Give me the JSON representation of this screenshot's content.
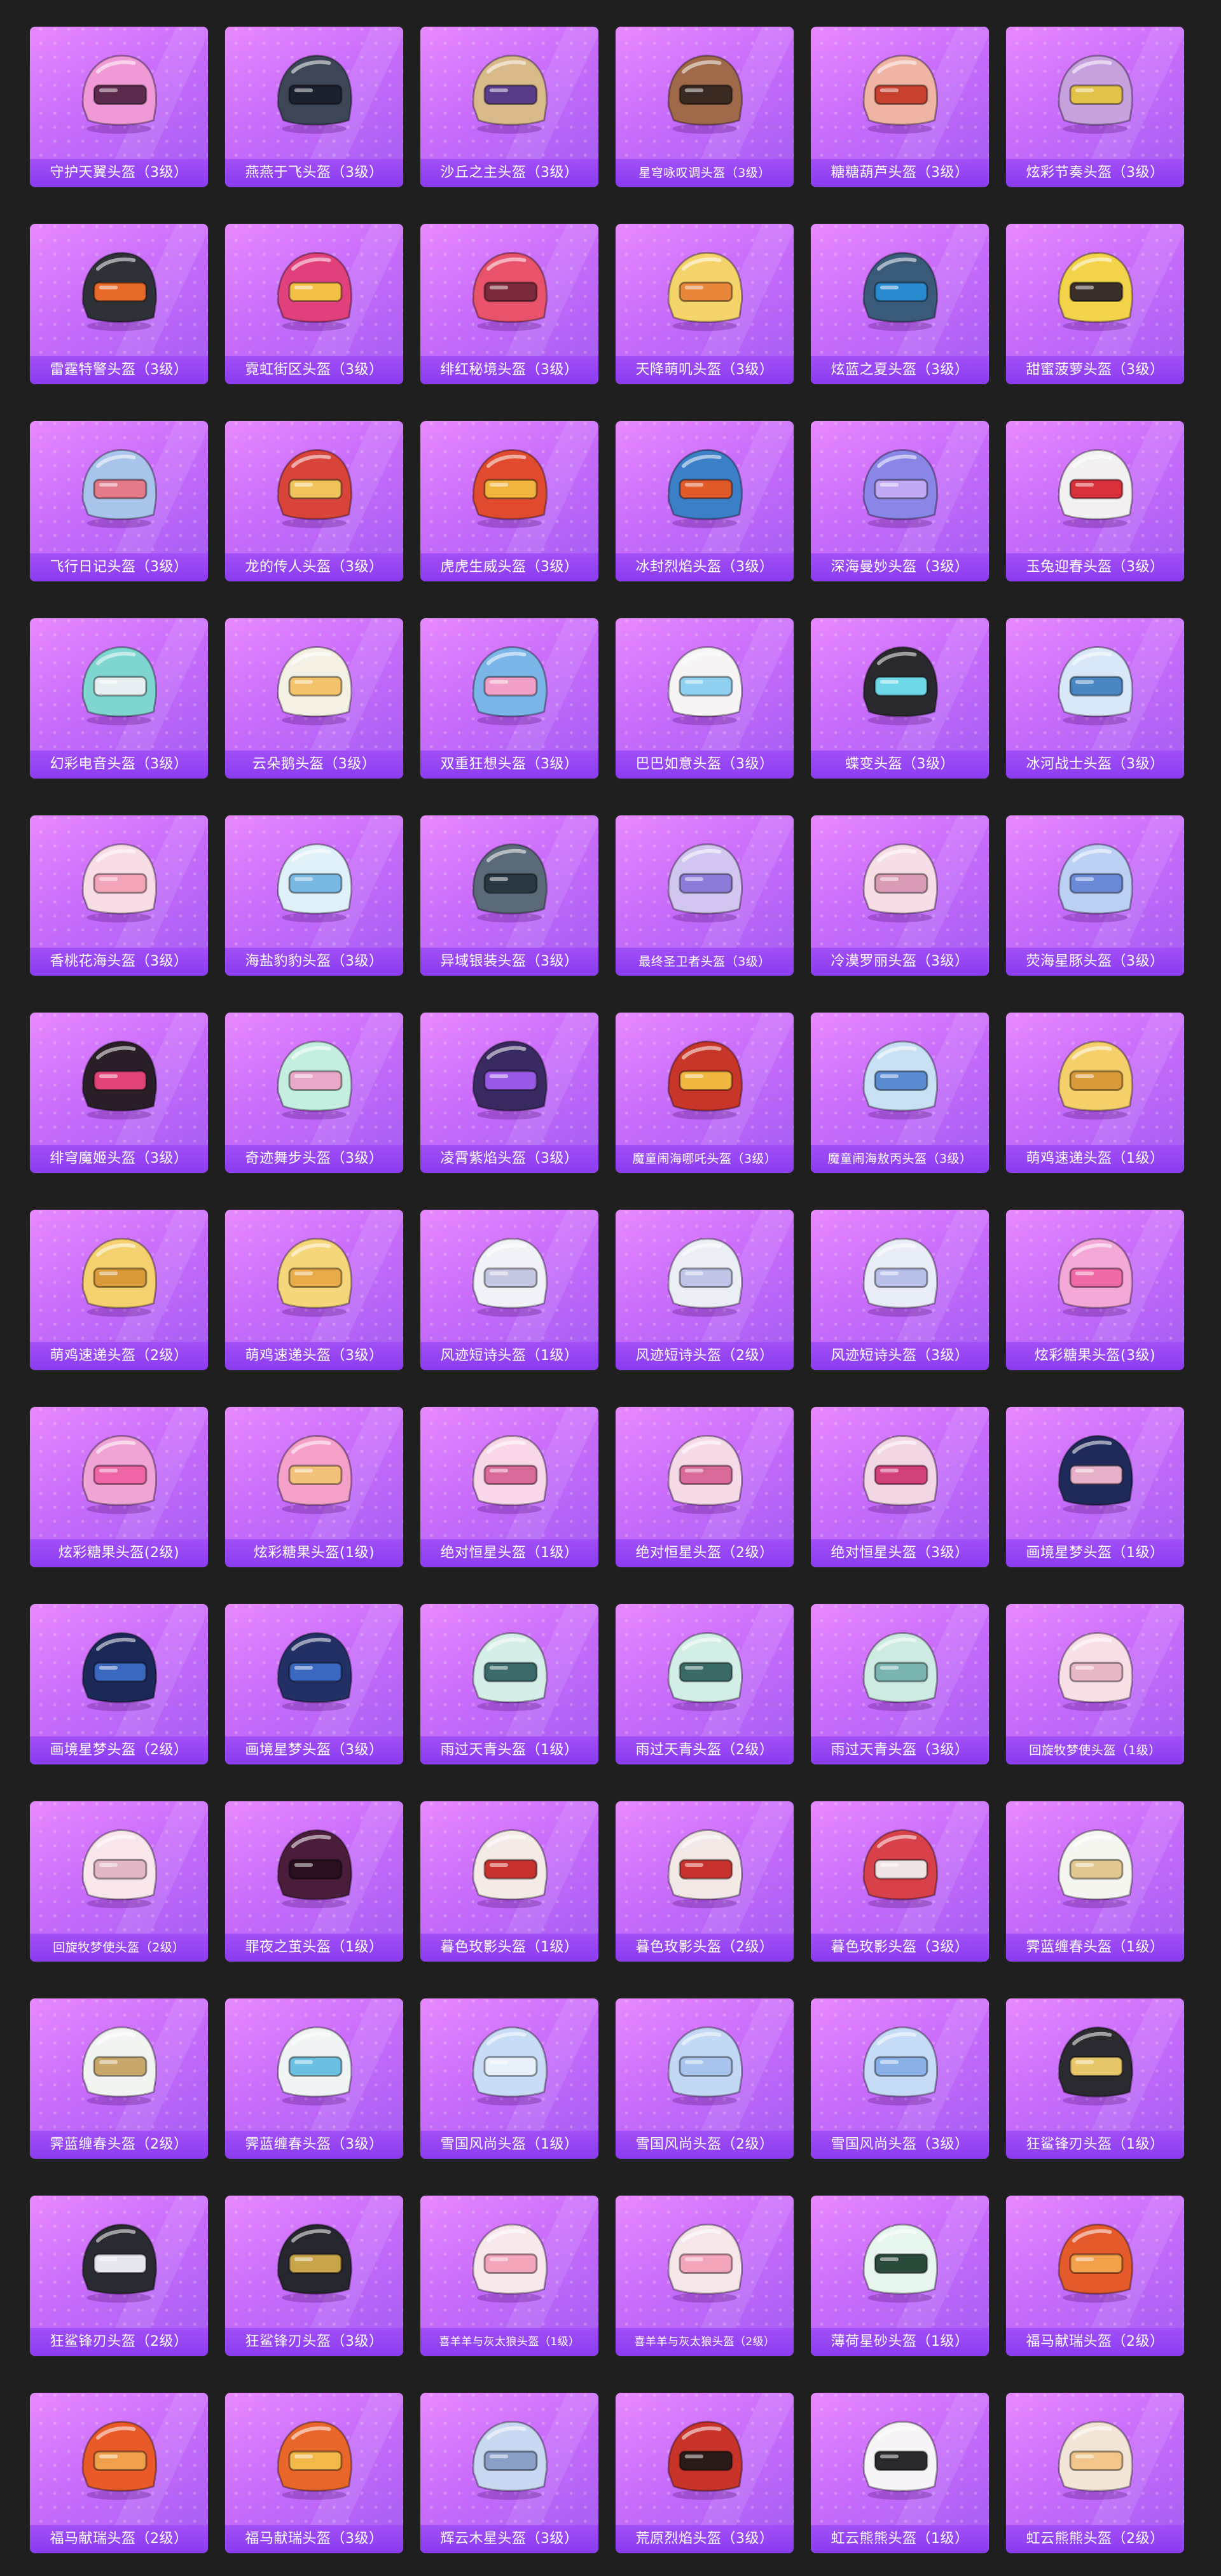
{
  "items": [
    {
      "name": "守护天翼头盔（3级）",
      "shell": "#ef9ad6",
      "visor": "#5b2a4d"
    },
    {
      "name": "燕燕于飞头盔（3级）",
      "shell": "#3d4656",
      "visor": "#1c2130"
    },
    {
      "name": "沙丘之主头盔（3级）",
      "shell": "#d8b98a",
      "visor": "#5a3d8a"
    },
    {
      "name": "星穹咏叹调头盔（3级）",
      "shell": "#a06a4a",
      "visor": "#3a2a22"
    },
    {
      "name": "糖糖葫芦头盔（3级）",
      "shell": "#f0b4a4",
      "visor": "#c8412f"
    },
    {
      "name": "炫彩节奏头盔（3级）",
      "shell": "#c7a1dd",
      "visor": "#e2c24a"
    },
    {
      "name": "雷霆特警头盔（3级）",
      "shell": "#2f3138",
      "visor": "#e86a2a"
    },
    {
      "name": "霓虹街区头盔（3级）",
      "shell": "#e0417c",
      "visor": "#f2c046"
    },
    {
      "name": "绯红秘境头盔（3级）",
      "shell": "#e8526a",
      "visor": "#7a2a3a"
    },
    {
      "name": "天降萌叽头盔（3级）",
      "shell": "#f4d46a",
      "visor": "#e8873a"
    },
    {
      "name": "炫蓝之夏头盔（3级）",
      "shell": "#3a5a7a",
      "visor": "#2a8ad0"
    },
    {
      "name": "甜蜜菠萝头盔（3级）",
      "shell": "#f2d34a",
      "visor": "#3a2f2a"
    },
    {
      "name": "飞行日记头盔（3级）",
      "shell": "#a8c4ea",
      "visor": "#e37b8b"
    },
    {
      "name": "龙的传人头盔（3级）",
      "shell": "#d8443a",
      "visor": "#f0c45a"
    },
    {
      "name": "虎虎生威头盔（3级）",
      "shell": "#e04a2e",
      "visor": "#f2b640"
    },
    {
      "name": "冰封烈焰头盔（3级）",
      "shell": "#3b7fc6",
      "visor": "#e05a2a"
    },
    {
      "name": "深海曼妙头盔（3级）",
      "shell": "#8a86e8",
      "visor": "#c2a9f4"
    },
    {
      "name": "玉兔迎春头盔（3级）",
      "shell": "#f2f0f0",
      "visor": "#d8303a"
    },
    {
      "name": "幻彩电音头盔（3级）",
      "shell": "#7fd6d0",
      "visor": "#e6eef2"
    },
    {
      "name": "云朵鹅头盔（3级）",
      "shell": "#f4f1e4",
      "visor": "#f2c36a"
    },
    {
      "name": "双重狂想头盔（3级）",
      "shell": "#7ab6e8",
      "visor": "#f0a0c6"
    },
    {
      "name": "巴巴如意头盔（3级）",
      "shell": "#f6f4f4",
      "visor": "#8fd0f0"
    },
    {
      "name": "蝶变头盔（3级）",
      "shell": "#2a2a2e",
      "visor": "#6fd8e8"
    },
    {
      "name": "冰河战士头盔（3级）",
      "shell": "#d8e8f8",
      "visor": "#4a86c2"
    },
    {
      "name": "香桃花海头盔（3级）",
      "shell": "#f8dce6",
      "visor": "#f2a4b8"
    },
    {
      "name": "海盐豹豹头盔（3级）",
      "shell": "#dff0f8",
      "visor": "#7ab8e4"
    },
    {
      "name": "异域银装头盔（3级）",
      "shell": "#5a6a78",
      "visor": "#2a3844"
    },
    {
      "name": "最终圣卫者头盔（3级）",
      "shell": "#d2c6f0",
      "visor": "#8e7ad8"
    },
    {
      "name": "冷漠罗丽头盔（3级）",
      "shell": "#f6dde6",
      "visor": "#d89ab4"
    },
    {
      "name": "荧海星豚头盔（3级）",
      "shell": "#bcd0f4",
      "visor": "#6a8ad8"
    },
    {
      "name": "绯穹魔姬头盔（3级）",
      "shell": "#2a1f28",
      "visor": "#e2447a"
    },
    {
      "name": "奇迹舞步头盔（3级）",
      "shell": "#c4efe0",
      "visor": "#e8a8c8"
    },
    {
      "name": "凌霄紫焰头盔（3级）",
      "shell": "#3a2a62",
      "visor": "#9a5ae8"
    },
    {
      "name": "魔童闹海哪吒头盔（3级）",
      "shell": "#c8362a",
      "visor": "#f0b840"
    },
    {
      "name": "魔童闹海敖丙头盔（3级）",
      "shell": "#c8e0f4",
      "visor": "#5a8ad0"
    },
    {
      "name": "萌鸡速递头盔（1级）",
      "shell": "#f4cf6a",
      "visor": "#d99a3a"
    },
    {
      "name": "萌鸡速递头盔（2级）",
      "shell": "#f4d06e",
      "visor": "#d99a3a"
    },
    {
      "name": "萌鸡速递头盔（3级）",
      "shell": "#f6d67a",
      "visor": "#e8ab4a"
    },
    {
      "name": "风迹短诗头盔（1级）",
      "shell": "#f0f2f8",
      "visor": "#c4c8e0"
    },
    {
      "name": "风迹短诗头盔（2级）",
      "shell": "#eceef6",
      "visor": "#c0c4e6"
    },
    {
      "name": "风迹短诗头盔（3级）",
      "shell": "#e8ecf6",
      "visor": "#b8c0ea"
    },
    {
      "name": "炫彩糖果头盔(3级)",
      "shell": "#f4a8d8",
      "visor": "#f06aa8"
    },
    {
      "name": "炫彩糖果头盔(2级)",
      "shell": "#f0a4d6",
      "visor": "#ee66a6"
    },
    {
      "name": "炫彩糖果头盔(1级)",
      "shell": "#f4a0c8",
      "visor": "#f2c27a"
    },
    {
      "name": "绝对恒星头盔（1级）",
      "shell": "#f8d8e8",
      "visor": "#d86a9a"
    },
    {
      "name": "绝对恒星头盔（2级）",
      "shell": "#f6dae8",
      "visor": "#d86a9a"
    },
    {
      "name": "绝对恒星头盔（3级）",
      "shell": "#f2d6e4",
      "visor": "#d2407a"
    },
    {
      "name": "画境星梦头盔（1级）",
      "shell": "#1f2a5a",
      "visor": "#e6b0c8"
    },
    {
      "name": "画境星梦头盔（2级）",
      "shell": "#1c2858",
      "visor": "#3a68c0"
    },
    {
      "name": "画境星梦头盔（3级）",
      "shell": "#223066",
      "visor": "#3a68c0"
    },
    {
      "name": "雨过天青头盔（1级）",
      "shell": "#d6eee8",
      "visor": "#3a6a6a"
    },
    {
      "name": "雨过天青头盔（2级）",
      "shell": "#d2eee6",
      "visor": "#3a6a66"
    },
    {
      "name": "雨过天青头盔（3级）",
      "shell": "#cdebe2",
      "visor": "#7ab4b0"
    },
    {
      "name": "回旋牧梦使头盔（1级）",
      "shell": "#f8e0e6",
      "visor": "#e8b8c6"
    },
    {
      "name": "回旋牧梦使头盔（2级）",
      "shell": "#f8e6ea",
      "visor": "#e2b8c6"
    },
    {
      "name": "罪夜之茧头盔（1级）",
      "shell": "#4a1e3a",
      "visor": "#2a0f20"
    },
    {
      "name": "暮色玫影头盔（1级）",
      "shell": "#f4ebe6",
      "visor": "#c8322e"
    },
    {
      "name": "暮色玫影头盔（2级）",
      "shell": "#f2e8e6",
      "visor": "#c8322e"
    },
    {
      "name": "暮色玫影头盔（3级）",
      "shell": "#d8404a",
      "visor": "#f0e4e6"
    },
    {
      "name": "霁蓝缠春头盔（1级）",
      "shell": "#f6f6f0",
      "visor": "#e0c890"
    },
    {
      "name": "霁蓝缠春头盔（2级）",
      "shell": "#f2f4f2",
      "visor": "#c8a86a"
    },
    {
      "name": "霁蓝缠春头盔（3级）",
      "shell": "#f0f4f4",
      "visor": "#6ac0e0"
    },
    {
      "name": "雪国风尚头盔（1级）",
      "shell": "#c8dcf6",
      "visor": "#e8f0fa"
    },
    {
      "name": "雪国风尚头盔（2级）",
      "shell": "#c2d8f4",
      "visor": "#a8c4ec"
    },
    {
      "name": "雪国风尚头盔（3级）",
      "shell": "#c6dcf6",
      "visor": "#8ab0e8"
    },
    {
      "name": "狂鲨锋刃头盔（1级）",
      "shell": "#2a2a30",
      "visor": "#e8c66a"
    },
    {
      "name": "狂鲨锋刃头盔（2级）",
      "shell": "#2a2a32",
      "visor": "#e6e6ee"
    },
    {
      "name": "狂鲨锋刃头盔（3级）",
      "shell": "#26262e",
      "visor": "#c8a44a"
    },
    {
      "name": "喜羊羊与灰太狼头盔（1级）",
      "shell": "#f8e8ec",
      "visor": "#f2a4b8"
    },
    {
      "name": "喜羊羊与灰太狼头盔（2级）",
      "shell": "#f6e6ea",
      "visor": "#f2a4b8"
    },
    {
      "name": "薄荷星砂头盔（1级）",
      "shell": "#e6f6ee",
      "visor": "#2a4a3a"
    },
    {
      "name": "福马献瑞头盔（2级）",
      "shell": "#e45a2a",
      "visor": "#f2a04a"
    },
    {
      "name": "福马献瑞头盔（2级）",
      "shell": "#e85a28",
      "visor": "#f0a04a"
    },
    {
      "name": "福马献瑞头盔（3级）",
      "shell": "#e8662a",
      "visor": "#f2b84a"
    },
    {
      "name": "辉云木星头盔（3级）",
      "shell": "#c8d8f0",
      "visor": "#8aa0c8"
    },
    {
      "name": "荒原烈焰头盔（3级）",
      "shell": "#c8342a",
      "visor": "#2a1a18"
    },
    {
      "name": "虹云熊熊头盔（1级）",
      "shell": "#f6f4f6",
      "visor": "#2a2a2e"
    },
    {
      "name": "虹云熊熊头盔（2级）",
      "shell": "#f2e4d6",
      "visor": "#f2c68a"
    }
  ]
}
